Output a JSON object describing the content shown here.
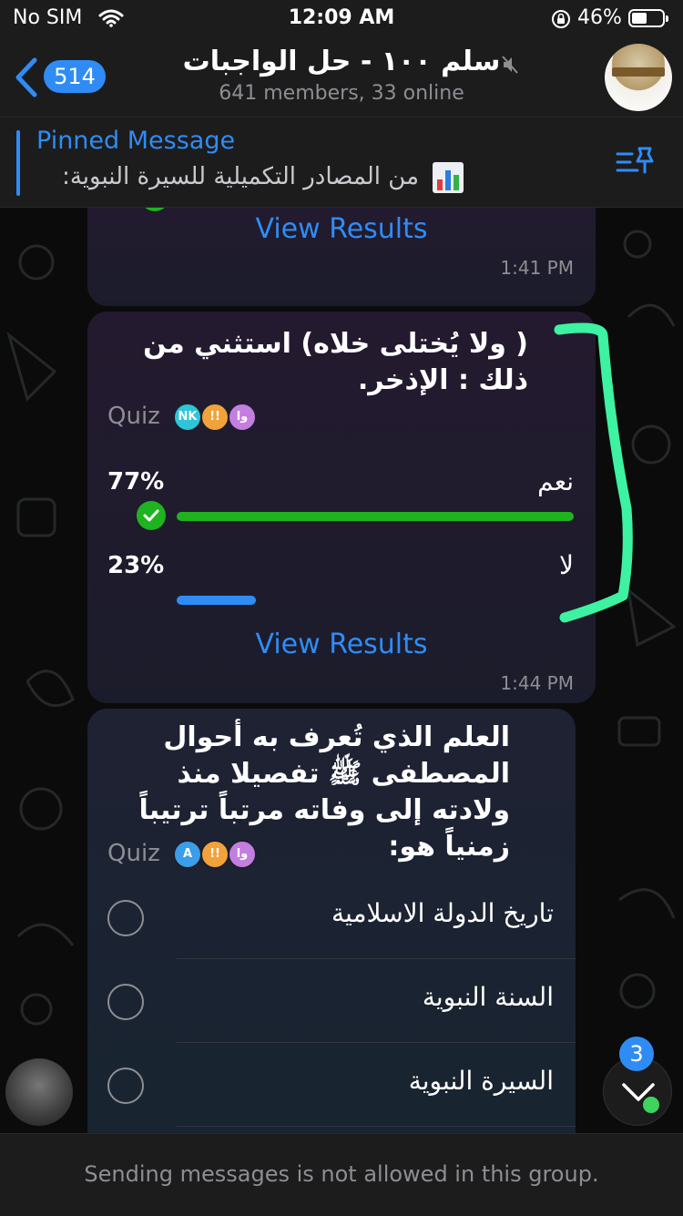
{
  "status": {
    "carrier": "No SIM",
    "time": "12:09 AM",
    "battery": "46%"
  },
  "header": {
    "back_count": "514",
    "title": "سلم ١٠٠ - حل الواجبات",
    "subtitle": "641 members, 33 online"
  },
  "pinned": {
    "title": "Pinned Message",
    "text": "من المصادر التكميلية للسيرة النبوية:"
  },
  "messages": [
    {
      "view_results": "View Results",
      "time": "1:41 PM"
    },
    {
      "question": "( ولا يُختلى خلاه) استثني من ذلك : الإذخر.",
      "quiz_label": "Quiz",
      "voters": [
        "NK",
        "!!",
        "وا"
      ],
      "options": [
        {
          "label": "نعم",
          "percent": "77%",
          "value": 0.77,
          "correct": true
        },
        {
          "label": "لا",
          "percent": "23%",
          "value": 0.23,
          "correct": false
        }
      ],
      "view_results": "View Results",
      "time": "1:44 PM"
    },
    {
      "question": "العلم الذي تُعرف به أحوال المصطفى ﷺ تفصيلا منذ ولادته إلى وفاته مرتباً ترتيباً زمنياً هو:",
      "quiz_label": "Quiz",
      "voters": [
        "A",
        "!!",
        "وا"
      ],
      "options": [
        "تاريخ الدولة الاسلامية",
        "السنة النبوية",
        "السيرة النبوية"
      ]
    }
  ],
  "scroll_badge": "3",
  "footer": {
    "notice": "Sending messages is not allowed in this group."
  },
  "colors": {
    "accent": "#2f8cf5",
    "correct": "#1fb31f",
    "highlight": "#3df2a0",
    "bubble": "#211c2e"
  }
}
